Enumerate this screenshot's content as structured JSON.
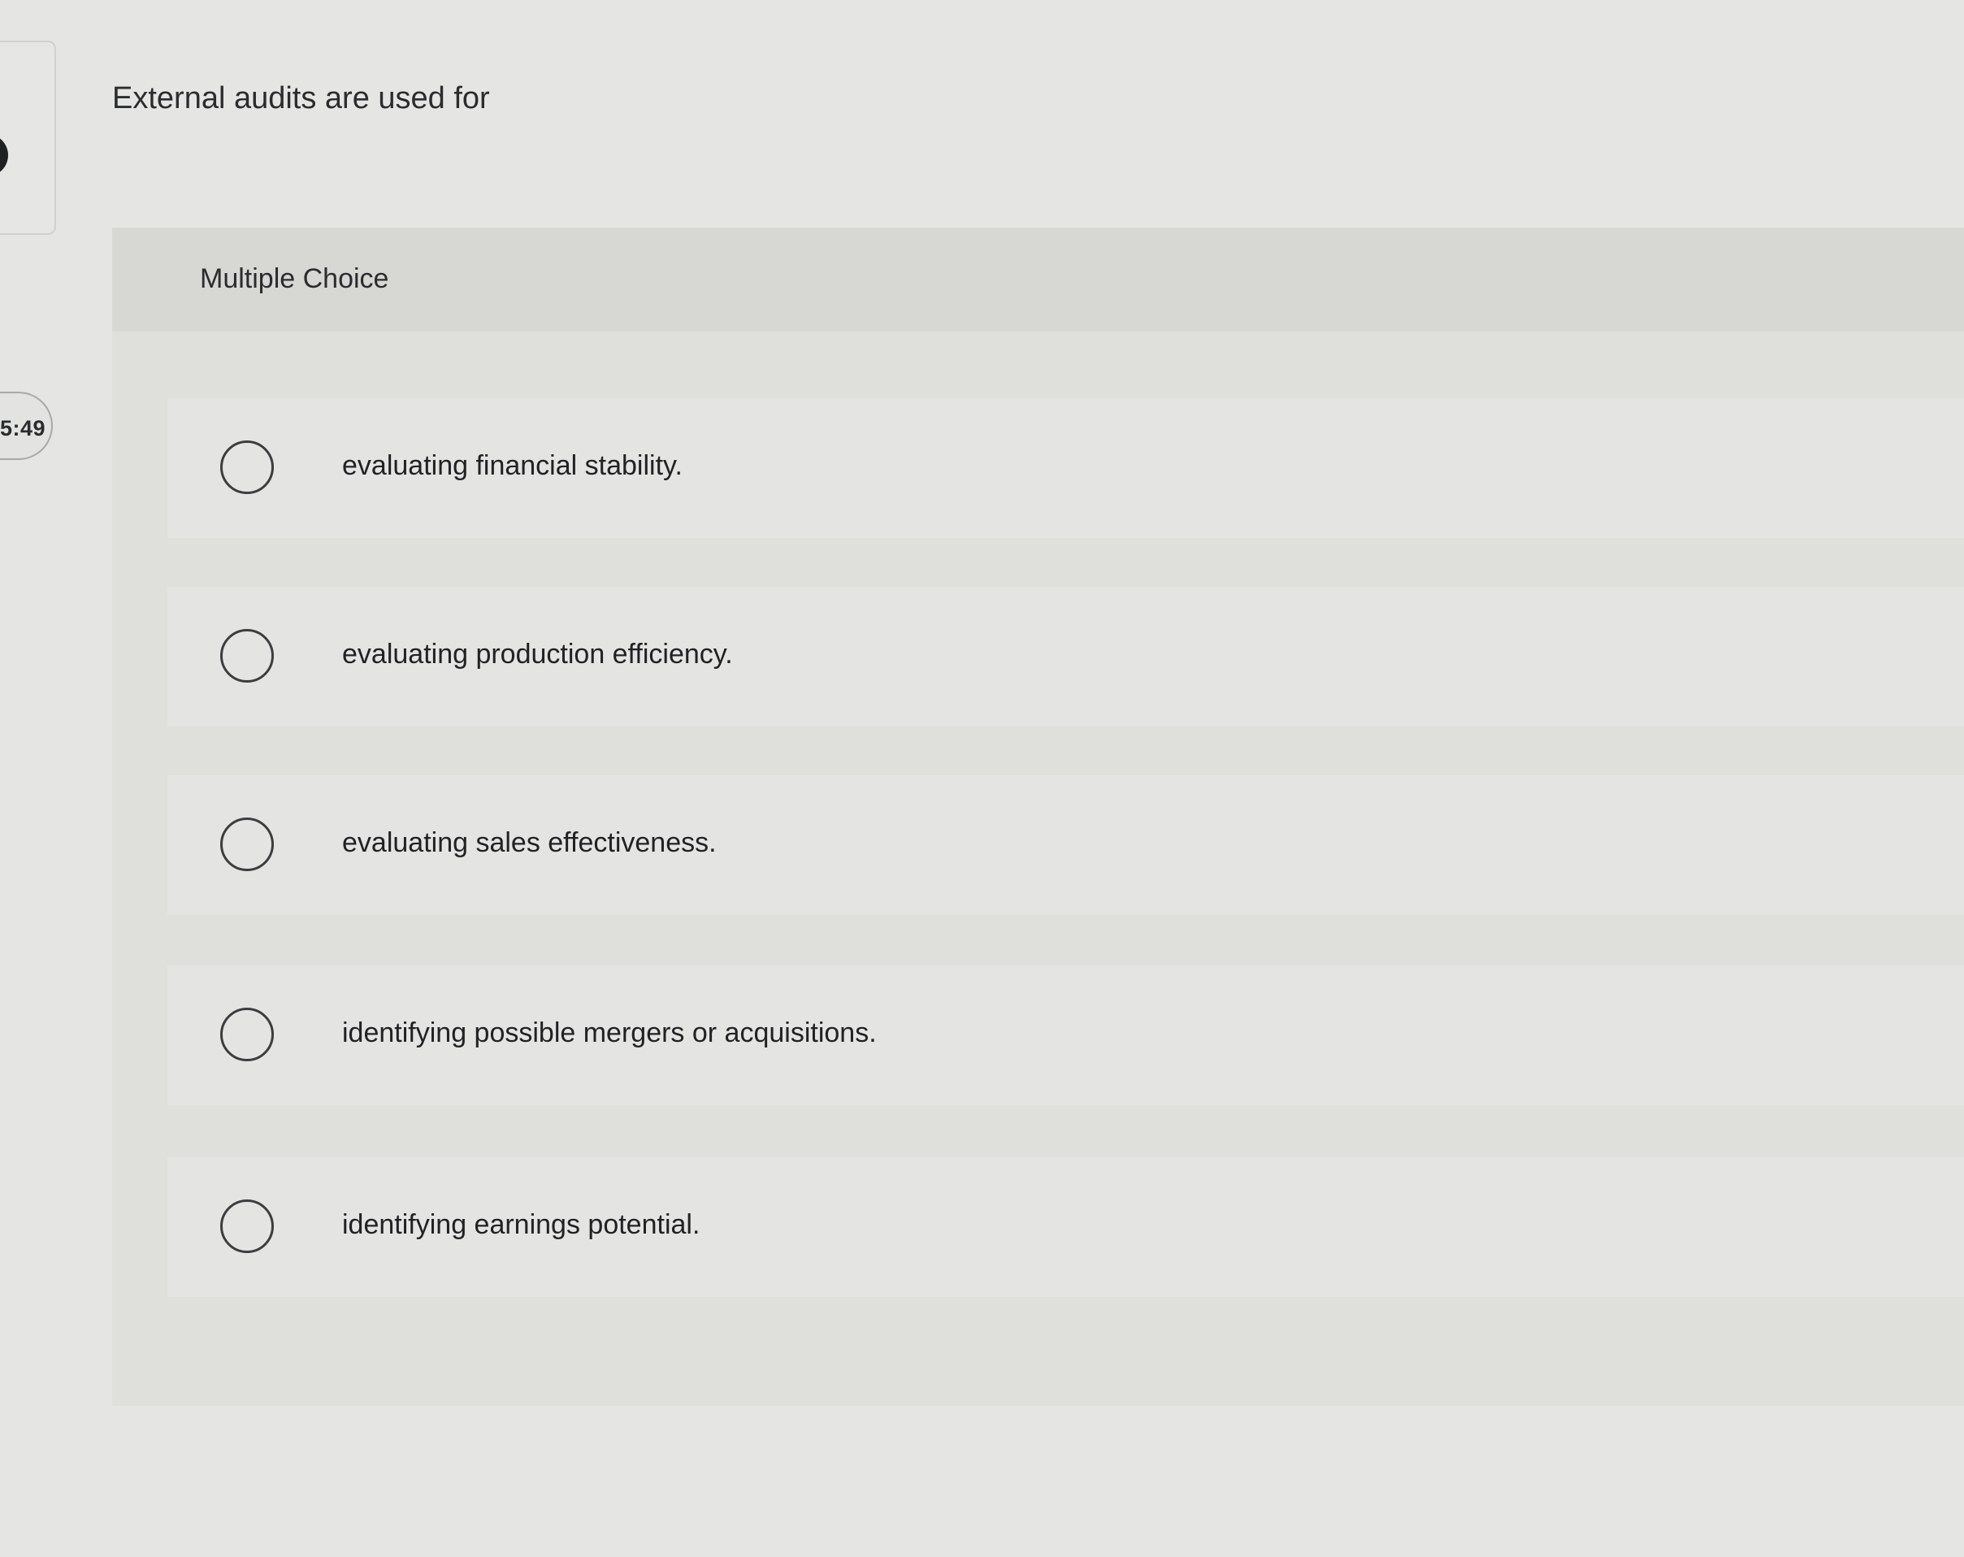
{
  "timer": {
    "text": "5:49"
  },
  "question": {
    "text": "External audits are used for"
  },
  "panel": {
    "header_label": "Multiple Choice",
    "options": [
      {
        "label": "evaluating financial stability."
      },
      {
        "label": "evaluating production efficiency."
      },
      {
        "label": "evaluating sales effectiveness."
      },
      {
        "label": "identifying possible mergers or acquisitions."
      },
      {
        "label": "identifying earnings potential."
      }
    ]
  }
}
